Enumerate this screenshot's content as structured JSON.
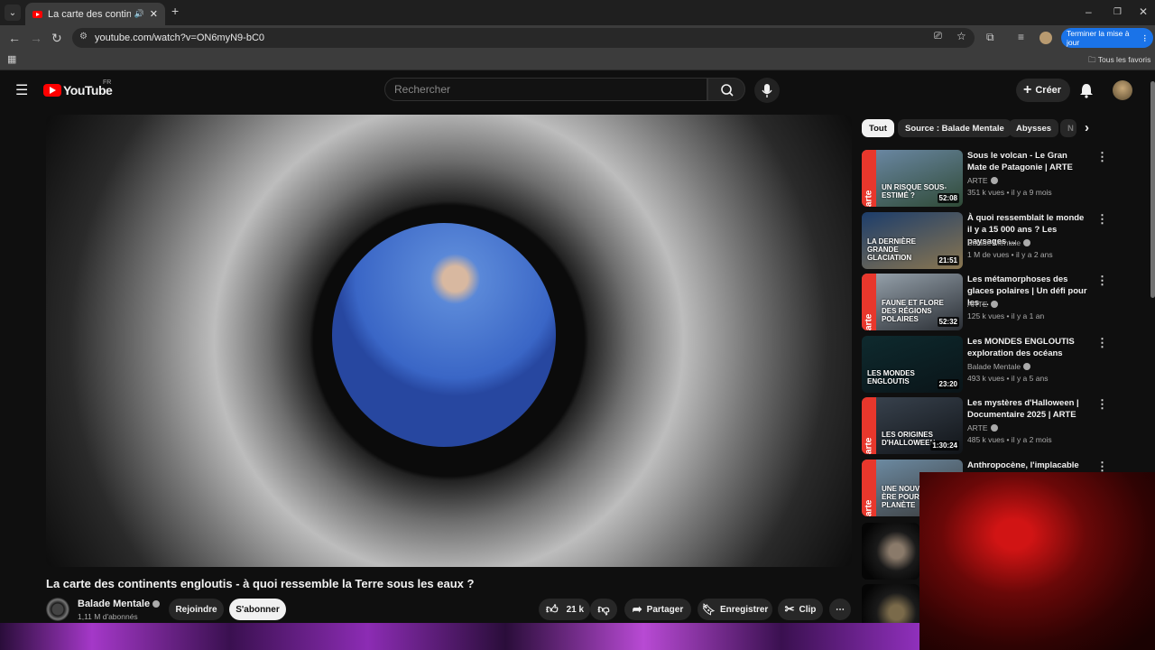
{
  "browser": {
    "tab_title": "La carte des continents engloutis",
    "url": "youtube.com/watch?v=ON6myN9-bC0",
    "update_label": "Terminer la mise à jour",
    "bookmarks_label": "Tous les favoris"
  },
  "header": {
    "logo": "YouTube",
    "region": "FR",
    "search_placeholder": "Rechercher",
    "create_label": "Créer"
  },
  "video": {
    "title": "La carte des continents engloutis - à quoi ressemble la Terre sous les eaux ?",
    "channel": "Balade Mentale",
    "subscribers": "1,11 M d'abonnés",
    "join_label": "Rejoindre",
    "subscribe_label": "S'abonner",
    "likes": "21 k",
    "share_label": "Partager",
    "save_label": "Enregistrer",
    "clip_label": "Clip"
  },
  "chips": [
    "Tout",
    "Source : Balade Mentale",
    "Abysses",
    "N"
  ],
  "recommendations": [
    {
      "title": "Sous le volcan - Le Gran Mate de Patagonie | ARTE",
      "channel": "ARTE",
      "meta": "351 k vues • il y a 9 mois",
      "duration": "52:08",
      "thumb_text": "UN RISQUE SOUS-ESTIMÉ ?",
      "arte": true,
      "colors": [
        "#6d8aa8",
        "#2f4a36"
      ]
    },
    {
      "title": "À quoi ressemblait le monde il y a 15 000 ans ? Les paysages ...",
      "channel": "Balade Mentale",
      "meta": "1 M de vues • il y a 2 ans",
      "duration": "21:51",
      "thumb_text": "LA DERNIÈRE GRANDE GLACIATION",
      "arte": false,
      "colors": [
        "#1c3d6b",
        "#8a7650"
      ]
    },
    {
      "title": "Les métamorphoses des glaces polaires | Un défi pour les ...",
      "channel": "ARTE",
      "meta": "125 k vues • il y a 1 an",
      "duration": "52:32",
      "thumb_text": "FAUNE ET FLORE DES RÉGIONS POLAIRES",
      "arte": true,
      "colors": [
        "#9aa6b0",
        "#2a2e34"
      ]
    },
    {
      "title": "Les MONDES ENGLOUTIS exploration des océans",
      "channel": "Balade Mentale",
      "meta": "493 k vues • il y a 5 ans",
      "duration": "23:20",
      "thumb_text": "LES MONDES ENGLOUTIS",
      "arte": false,
      "colors": [
        "#0e2a2e",
        "#0a1418"
      ]
    },
    {
      "title": "Les mystères d'Halloween | Documentaire 2025 | ARTE",
      "channel": "ARTE",
      "meta": "485 k vues • il y a 2 mois",
      "duration": "1:30:24",
      "thumb_text": "LES ORIGINES D'HALLOWEEN",
      "arte": true,
      "colors": [
        "#3a4450",
        "#111418"
      ]
    },
    {
      "title": "Anthropocène, l'implacable",
      "channel": "",
      "meta": "",
      "duration": "",
      "thumb_text": "UNE NOUVELLE ÈRE POUR LA PLANÈTE",
      "arte": true,
      "colors": [
        "#6f8fa8",
        "#3a3a3a"
      ]
    }
  ]
}
